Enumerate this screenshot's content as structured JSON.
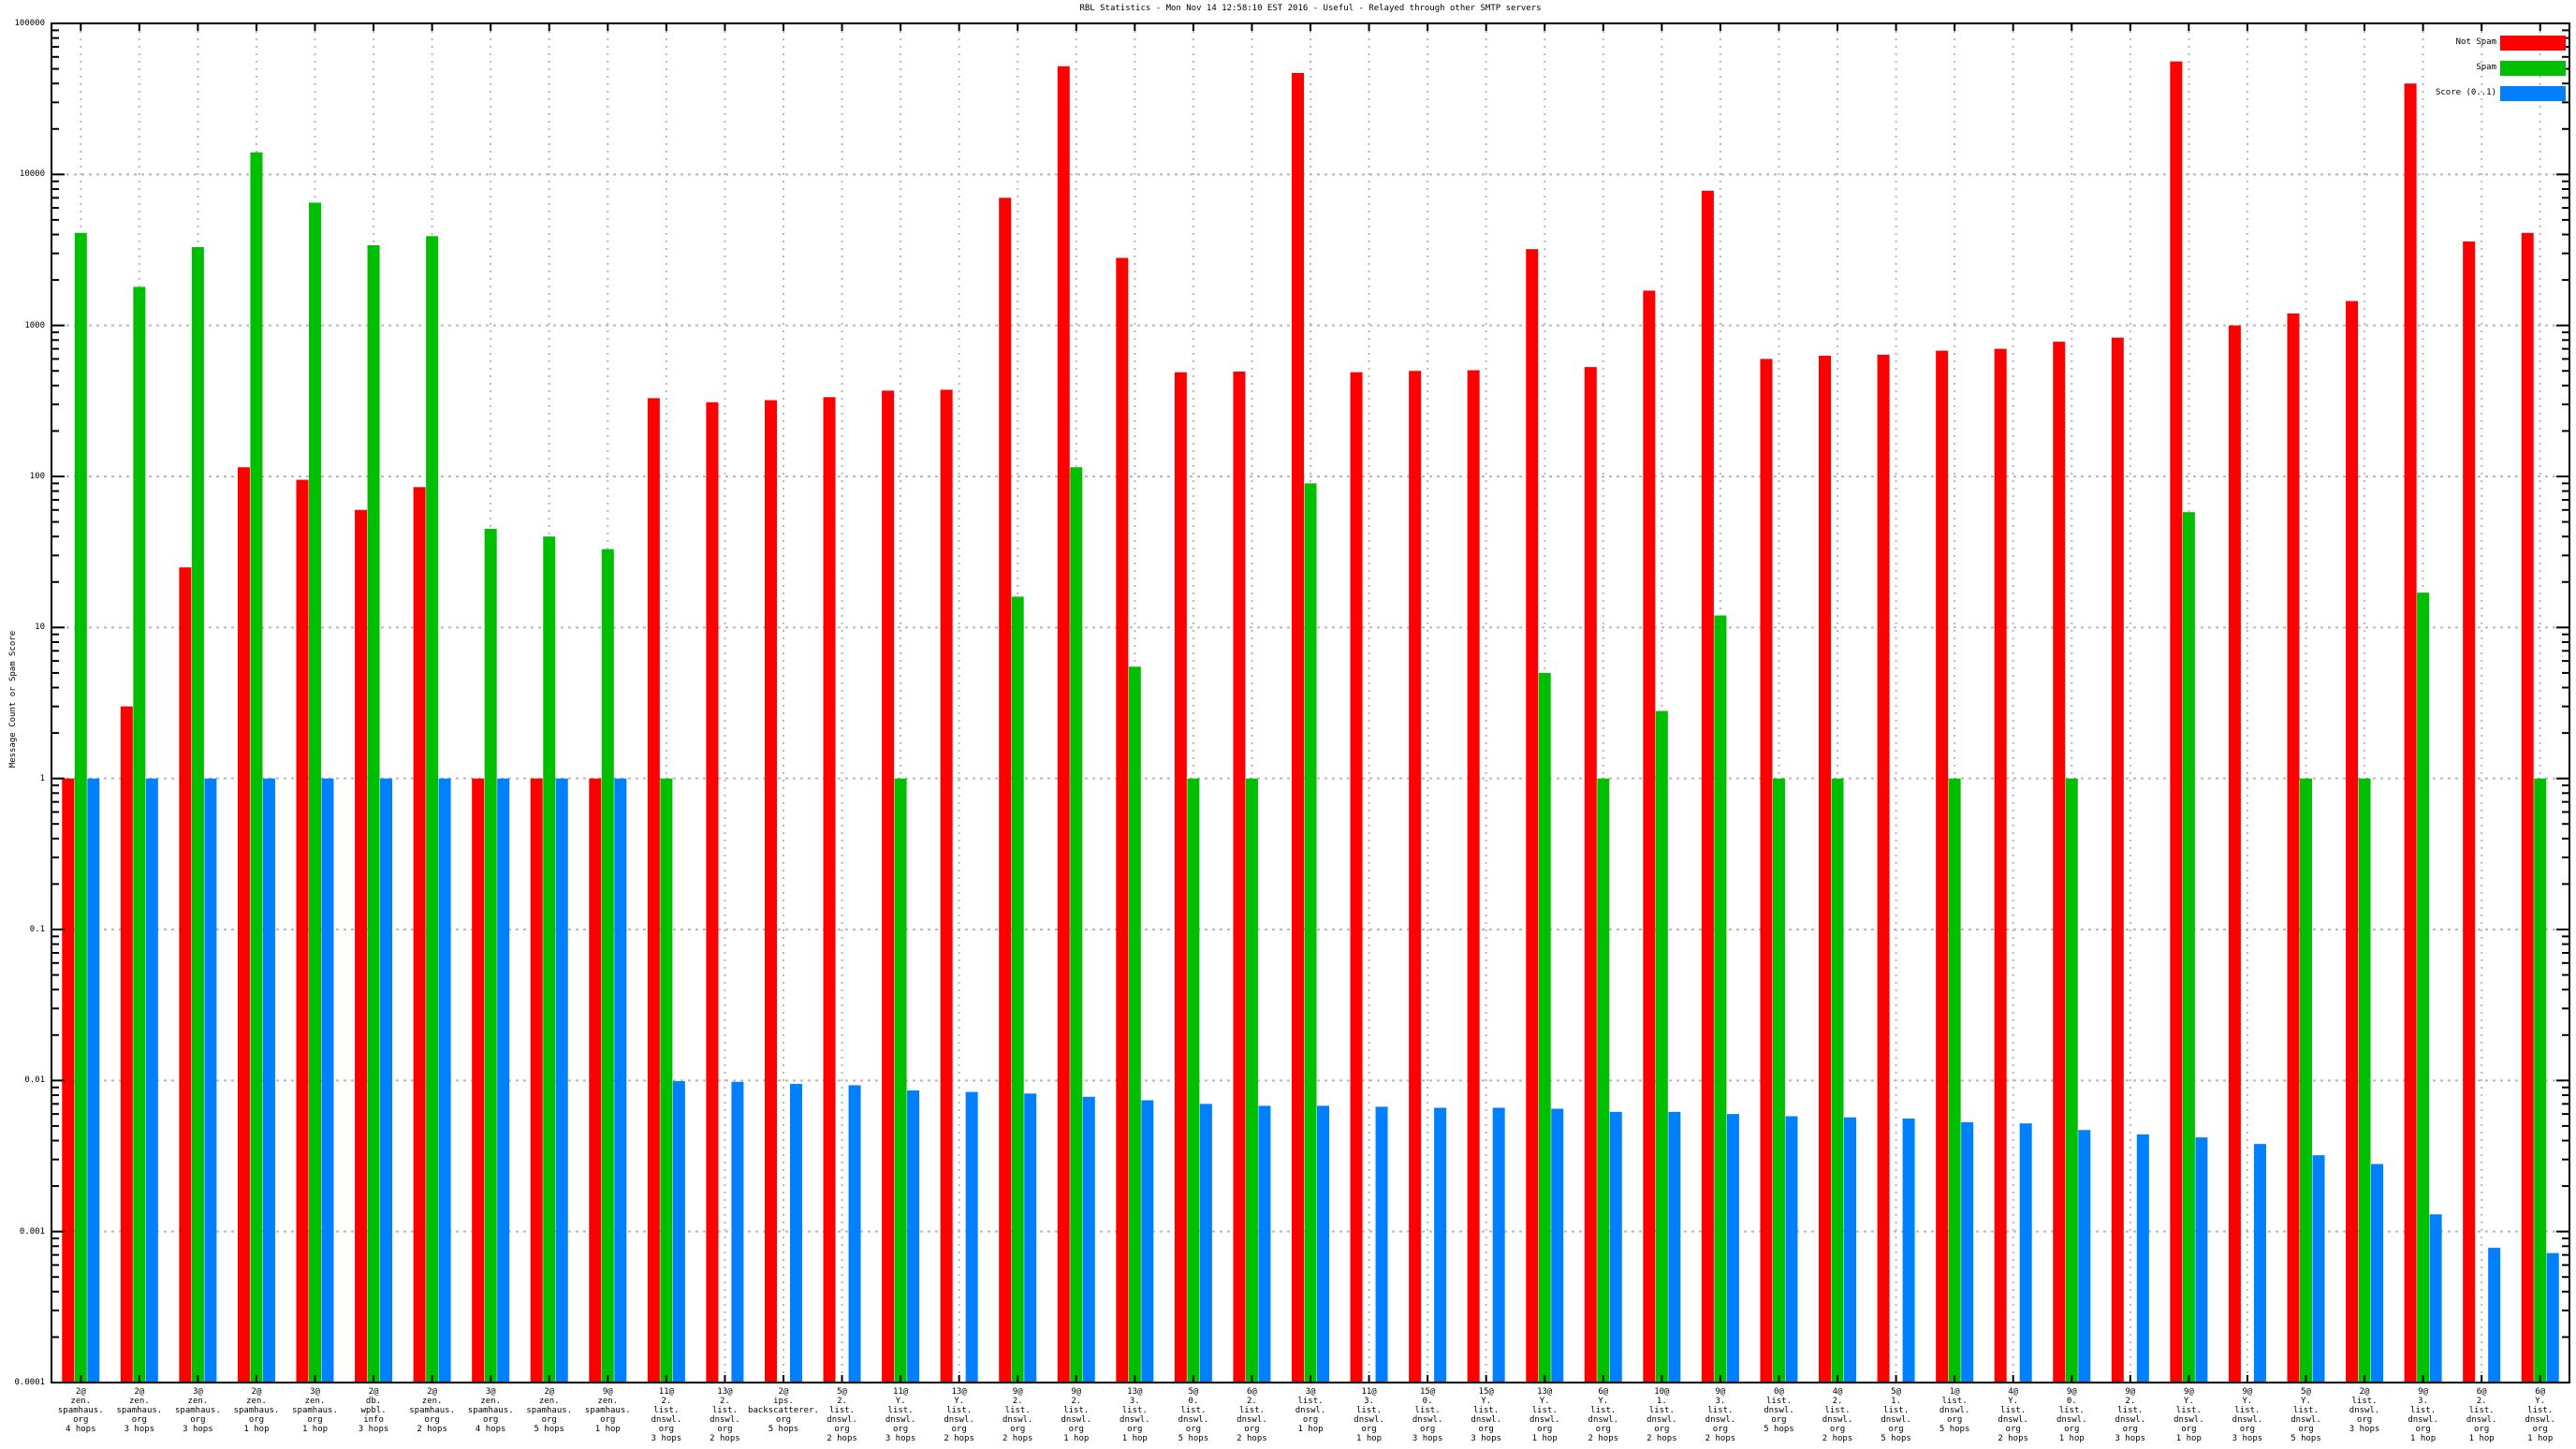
{
  "title": "RBL Statistics - Mon Nov 14 12:58:10 EST 2016 - Useful - Relayed through other SMTP servers",
  "colors": {
    "not_spam": "#ff0000",
    "spam": "#00bf00",
    "score": "#0080ff",
    "axis": "#000000",
    "grid": "#b8b8b8"
  },
  "chart_data": {
    "type": "bar",
    "title": "RBL Statistics - Mon Nov 14 12:58:10 EST 2016 - Useful - Relayed through other SMTP servers",
    "xlabel": "",
    "ylabel": "Message Count or Spam Score",
    "y_scale": "log10",
    "ylim": [
      0.0001,
      100000
    ],
    "grid": true,
    "legend_position": "top-right",
    "y_tick_labels": [
      "100000",
      "10000",
      "1000",
      "100",
      "10",
      "1",
      "0.1",
      "0.01",
      "0.001",
      "0.0001"
    ],
    "series_names": [
      "Not Spam",
      "Spam",
      "Score (0..1)"
    ],
    "legend": [
      {
        "name": "Not Spam",
        "color": "#ff0000"
      },
      {
        "name": "Spam",
        "color": "#00bf00"
      },
      {
        "name": "Score (0..1)",
        "color": "#0080ff"
      }
    ],
    "groups": [
      {
        "label_lines": [
          "2@",
          "zen.",
          "spamhaus.",
          "org",
          "4 hops"
        ],
        "not_spam": 1,
        "spam": 4100,
        "score": 1
      },
      {
        "label_lines": [
          "2@",
          "zen.",
          "spamhaus.",
          "org",
          "3 hops"
        ],
        "not_spam": 3,
        "spam": 1800,
        "score": 1
      },
      {
        "label_lines": [
          "3@",
          "zen.",
          "spamhaus.",
          "org",
          "3 hops"
        ],
        "not_spam": 25,
        "spam": 3300,
        "score": 1
      },
      {
        "label_lines": [
          "2@",
          "zen.",
          "spamhaus.",
          "org",
          "1 hop"
        ],
        "not_spam": 115,
        "spam": 14000,
        "score": 1
      },
      {
        "label_lines": [
          "3@",
          "zen.",
          "spamhaus.",
          "org",
          "1 hop"
        ],
        "not_spam": 95,
        "spam": 6500,
        "score": 1
      },
      {
        "label_lines": [
          "2@",
          "db.",
          "wpbl.",
          "info",
          "3 hops"
        ],
        "not_spam": 60,
        "spam": 3400,
        "score": 1
      },
      {
        "label_lines": [
          "2@",
          "zen.",
          "spamhaus.",
          "org",
          "2 hops"
        ],
        "not_spam": 85,
        "spam": 3900,
        "score": 1
      },
      {
        "label_lines": [
          "3@",
          "zen.",
          "spamhaus.",
          "org",
          "4 hops"
        ],
        "not_spam": 1,
        "spam": 45,
        "score": 1
      },
      {
        "label_lines": [
          "2@",
          "zen.",
          "spamhaus.",
          "org",
          "5 hops"
        ],
        "not_spam": 1,
        "spam": 40,
        "score": 1
      },
      {
        "label_lines": [
          "9@",
          "zen.",
          "spamhaus.",
          "org",
          "1 hop"
        ],
        "not_spam": 1,
        "spam": 33,
        "score": 1
      },
      {
        "label_lines": [
          "11@",
          "2.",
          "list.",
          "dnswl.",
          "org",
          "3 hops"
        ],
        "not_spam": 330,
        "spam": 1,
        "score": 0.0099
      },
      {
        "label_lines": [
          "13@",
          "2.",
          "list.",
          "dnswl.",
          "org",
          "2 hops"
        ],
        "not_spam": 310,
        "spam": null,
        "score": 0.0098
      },
      {
        "label_lines": [
          "2@",
          "ips.",
          "backscatterer.",
          "org",
          "5 hops"
        ],
        "not_spam": 320,
        "spam": null,
        "score": 0.0095
      },
      {
        "label_lines": [
          "5@",
          "2.",
          "list.",
          "dnswl.",
          "org",
          "2 hops"
        ],
        "not_spam": 335,
        "spam": null,
        "score": 0.0093
      },
      {
        "label_lines": [
          "11@",
          "Y.",
          "list.",
          "dnswl.",
          "org",
          "3 hops"
        ],
        "not_spam": 370,
        "spam": 1,
        "score": 0.0086
      },
      {
        "label_lines": [
          "13@",
          "Y.",
          "list.",
          "dnswl.",
          "org",
          "2 hops"
        ],
        "not_spam": 375,
        "spam": null,
        "score": 0.0084
      },
      {
        "label_lines": [
          "9@",
          "2.",
          "list.",
          "dnswl.",
          "org",
          "2 hops"
        ],
        "not_spam": 7000,
        "spam": 16,
        "score": 0.0082
      },
      {
        "label_lines": [
          "9@",
          "2.",
          "list.",
          "dnswl.",
          "org",
          "1 hop"
        ],
        "not_spam": 52000,
        "spam": 115,
        "score": 0.0078
      },
      {
        "label_lines": [
          "13@",
          "3.",
          "list.",
          "dnswl.",
          "org",
          "1 hop"
        ],
        "not_spam": 2800,
        "spam": 5.5,
        "score": 0.0074
      },
      {
        "label_lines": [
          "5@",
          "0.",
          "list.",
          "dnswl.",
          "org",
          "5 hops"
        ],
        "not_spam": 490,
        "spam": 1,
        "score": 0.007
      },
      {
        "label_lines": [
          "6@",
          "2.",
          "list.",
          "dnswl.",
          "org",
          "2 hops"
        ],
        "not_spam": 495,
        "spam": 1,
        "score": 0.0068
      },
      {
        "label_lines": [
          "3@",
          "list.",
          "dnswl.",
          "org",
          "1 hop"
        ],
        "not_spam": 47000,
        "spam": 90,
        "score": 0.0068
      },
      {
        "label_lines": [
          "11@",
          "3.",
          "list.",
          "dnswl.",
          "org",
          "1 hop"
        ],
        "not_spam": 490,
        "spam": null,
        "score": 0.0067
      },
      {
        "label_lines": [
          "15@",
          "0.",
          "list.",
          "dnswl.",
          "org",
          "3 hops"
        ],
        "not_spam": 500,
        "spam": null,
        "score": 0.0066
      },
      {
        "label_lines": [
          "15@",
          "Y.",
          "list.",
          "dnswl.",
          "org",
          "3 hops"
        ],
        "not_spam": 505,
        "spam": null,
        "score": 0.0066
      },
      {
        "label_lines": [
          "13@",
          "Y.",
          "list.",
          "dnswl.",
          "org",
          "1 hop"
        ],
        "not_spam": 3200,
        "spam": 5,
        "score": 0.0065
      },
      {
        "label_lines": [
          "6@",
          "Y.",
          "list.",
          "dnswl.",
          "org",
          "2 hops"
        ],
        "not_spam": 530,
        "spam": 1,
        "score": 0.0062
      },
      {
        "label_lines": [
          "10@",
          "1.",
          "list.",
          "dnswl.",
          "org",
          "2 hops"
        ],
        "not_spam": 1700,
        "spam": 2.8,
        "score": 0.0062
      },
      {
        "label_lines": [
          "9@",
          "3.",
          "list.",
          "dnswl.",
          "org",
          "2 hops"
        ],
        "not_spam": 7800,
        "spam": 12,
        "score": 0.006
      },
      {
        "label_lines": [
          "0@",
          "list.",
          "dnswl.",
          "org",
          "5 hops"
        ],
        "not_spam": 600,
        "spam": 1,
        "score": 0.0058
      },
      {
        "label_lines": [
          "4@",
          "2.",
          "list.",
          "dnswl.",
          "org",
          "2 hops"
        ],
        "not_spam": 630,
        "spam": 1,
        "score": 0.0057
      },
      {
        "label_lines": [
          "5@",
          "1.",
          "list.",
          "dnswl.",
          "org",
          "5 hops"
        ],
        "not_spam": 640,
        "spam": null,
        "score": 0.0056
      },
      {
        "label_lines": [
          "1@",
          "list.",
          "dnswl.",
          "org",
          "5 hops"
        ],
        "not_spam": 680,
        "spam": 1,
        "score": 0.0053
      },
      {
        "label_lines": [
          "4@",
          "Y.",
          "list.",
          "dnswl.",
          "org",
          "2 hops"
        ],
        "not_spam": 700,
        "spam": null,
        "score": 0.0052
      },
      {
        "label_lines": [
          "9@",
          "0.",
          "list.",
          "dnswl.",
          "org",
          "1 hop"
        ],
        "not_spam": 780,
        "spam": 1,
        "score": 0.0047
      },
      {
        "label_lines": [
          "9@",
          "2.",
          "list.",
          "dnswl.",
          "org",
          "3 hops"
        ],
        "not_spam": 830,
        "spam": null,
        "score": 0.0044
      },
      {
        "label_lines": [
          "9@",
          "Y.",
          "list.",
          "dnswl.",
          "org",
          "1 hop"
        ],
        "not_spam": 56000,
        "spam": 58,
        "score": 0.0042
      },
      {
        "label_lines": [
          "9@",
          "Y.",
          "list.",
          "dnswl.",
          "org",
          "3 hops"
        ],
        "not_spam": 1000,
        "spam": null,
        "score": 0.0038
      },
      {
        "label_lines": [
          "5@",
          "Y.",
          "list.",
          "dnswl.",
          "org",
          "5 hops"
        ],
        "not_spam": 1200,
        "spam": 1,
        "score": 0.0032
      },
      {
        "label_lines": [
          "2@",
          "list.",
          "dnswl.",
          "org",
          "3 hops"
        ],
        "not_spam": 1450,
        "spam": 1,
        "score": 0.0028
      },
      {
        "label_lines": [
          "9@",
          "3.",
          "list.",
          "dnswl.",
          "org",
          "1 hop"
        ],
        "not_spam": 40000,
        "spam": 17,
        "score": 0.0013
      },
      {
        "label_lines": [
          "6@",
          "2.",
          "list.",
          "dnswl.",
          "org",
          "1 hop"
        ],
        "not_spam": 3600,
        "spam": null,
        "score": 0.00078
      },
      {
        "label_lines": [
          "6@",
          "Y.",
          "list.",
          "dnswl.",
          "org",
          "1 hop"
        ],
        "not_spam": 4100,
        "spam": 1,
        "score": 0.00072
      }
    ]
  }
}
